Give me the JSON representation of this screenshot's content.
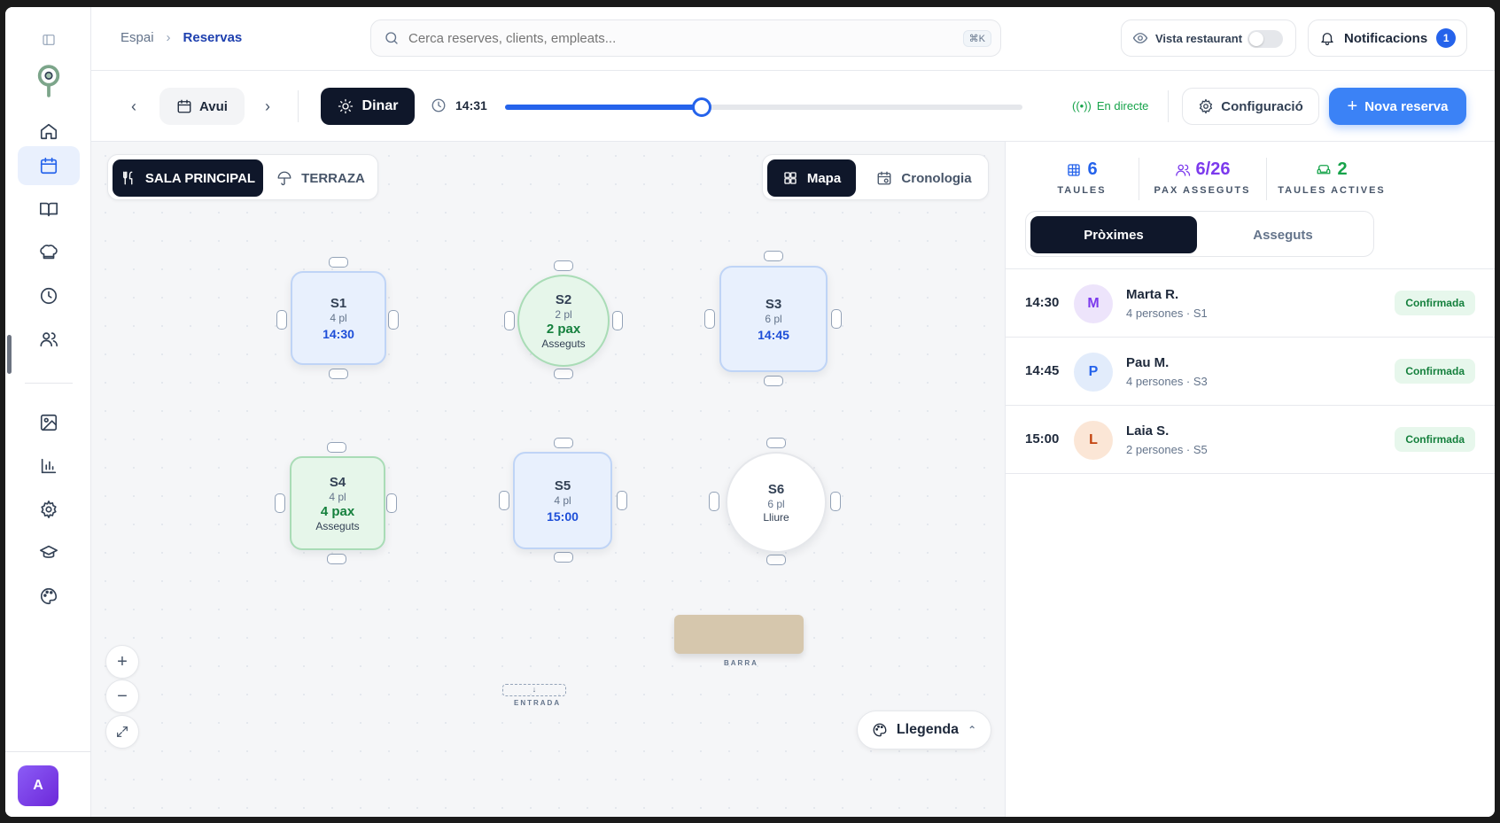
{
  "breadcrumb": {
    "root": "Espai",
    "current": "Reservas"
  },
  "search": {
    "placeholder": "Cerca reserves, clients, empleats...",
    "shortcut": "⌘K"
  },
  "header": {
    "vista_label": "Vista restaurant",
    "notif_label": "Notificacions",
    "notif_count": "1"
  },
  "toolbar": {
    "day_label": "Avui",
    "service_label": "Dinar",
    "time": "14:31",
    "slider_fraction": 0.38,
    "live_label": "En directe",
    "config_label": "Configuració",
    "new_label": "Nova reserva"
  },
  "rooms": [
    {
      "label": "SALA PRINCIPAL",
      "active": true
    },
    {
      "label": "TERRAZA",
      "active": false
    }
  ],
  "views": [
    {
      "label": "Mapa",
      "active": true
    },
    {
      "label": "Cronologia",
      "active": false
    }
  ],
  "tables": [
    {
      "name": "S1",
      "seats": "4 pl",
      "time": "14:30",
      "pax": "",
      "status": ""
    },
    {
      "name": "S2",
      "seats": "2 pl",
      "time": "",
      "pax": "2 pax",
      "status": "Asseguts"
    },
    {
      "name": "S3",
      "seats": "6 pl",
      "time": "14:45",
      "pax": "",
      "status": ""
    },
    {
      "name": "S4",
      "seats": "4 pl",
      "time": "",
      "pax": "4 pax",
      "status": "Asseguts"
    },
    {
      "name": "S5",
      "seats": "4 pl",
      "time": "15:00",
      "pax": "",
      "status": ""
    },
    {
      "name": "S6",
      "seats": "6 pl",
      "time": "",
      "pax": "",
      "status": "Lliure"
    }
  ],
  "map_labels": {
    "barra": "BARRA",
    "entrada": "ENTRADA",
    "legend": "Llegenda"
  },
  "stats": [
    {
      "value": "6",
      "label": "TAULES",
      "color": "#2563eb"
    },
    {
      "value": "6/26",
      "label": "PAX ASSEGUTS",
      "color": "#7c3aed"
    },
    {
      "value": "2",
      "label": "TAULES ACTIVES",
      "color": "#16a34a"
    }
  ],
  "panel_tabs": {
    "active": "Pròximes",
    "other": "Asseguts"
  },
  "reservations": [
    {
      "time": "14:30",
      "initial": "M",
      "name": "Marta R.",
      "detail": "4 persones · S1",
      "status": "Confirmada",
      "bg": "#ede4fb",
      "fg": "#7c3aed"
    },
    {
      "time": "14:45",
      "initial": "P",
      "name": "Pau M.",
      "detail": "4 persones · S3",
      "status": "Confirmada",
      "bg": "#e2ecfb",
      "fg": "#2563eb"
    },
    {
      "time": "15:00",
      "initial": "L",
      "name": "Laia S.",
      "detail": "2 persones · S5",
      "status": "Confirmada",
      "bg": "#fbe6d6",
      "fg": "#c2410c"
    }
  ],
  "user": {
    "initial": "A"
  }
}
